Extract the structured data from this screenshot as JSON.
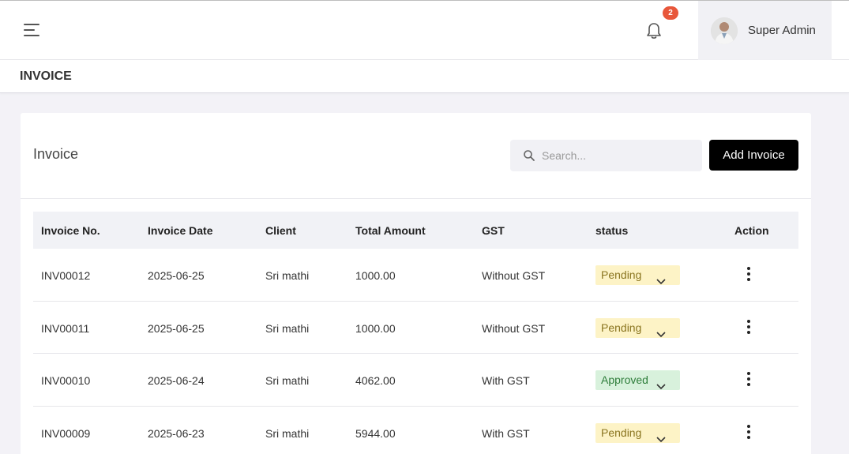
{
  "header": {
    "notification_count": "2",
    "user_name": "Super Admin"
  },
  "page": {
    "title": "INVOICE"
  },
  "card": {
    "title": "Invoice",
    "search_placeholder": "Search...",
    "add_button": "Add Invoice"
  },
  "table": {
    "columns": [
      "Invoice No.",
      "Invoice Date",
      "Client",
      "Total Amount",
      "GST",
      "status",
      "Action"
    ],
    "rows": [
      {
        "invoice_no": "INV00012",
        "date": "2025-06-25",
        "client": "Sri mathi",
        "amount": "1000.00",
        "gst": "Without GST",
        "status": "Pending"
      },
      {
        "invoice_no": "INV00011",
        "date": "2025-06-25",
        "client": "Sri mathi",
        "amount": "1000.00",
        "gst": "Without GST",
        "status": "Pending"
      },
      {
        "invoice_no": "INV00010",
        "date": "2025-06-24",
        "client": "Sri mathi",
        "amount": "4062.00",
        "gst": "With GST",
        "status": "Approved"
      },
      {
        "invoice_no": "INV00009",
        "date": "2025-06-23",
        "client": "Sri mathi",
        "amount": "5944.00",
        "gst": "With GST",
        "status": "Pending"
      }
    ]
  },
  "colors": {
    "pending_bg": "#fdf3c6",
    "approved_bg": "#d8f1dc",
    "badge": "#e8573b",
    "button": "#000000"
  }
}
